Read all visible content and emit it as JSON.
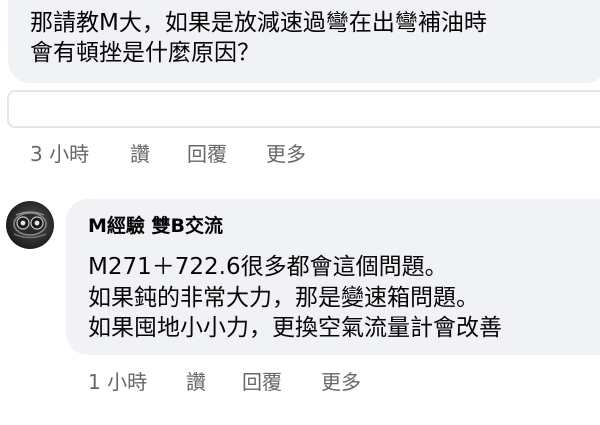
{
  "first_comment": {
    "text_line_1": "那請教M大，如果是放減速過彎在出彎補油時",
    "text_line_2": "會有頓挫是什麼原因？",
    "time": "3 小時",
    "like_label": "讚",
    "reply_label": "回覆",
    "more_label": "更多"
  },
  "reply_box": {
    "value": ""
  },
  "second_comment": {
    "author": "M經驗 雙B交流",
    "avatar_icon": "car-headlight-avatar",
    "message_lines": [
      "M271＋722.6很多都會這個問題。",
      "如果鈍的非常大力，那是變速箱問題。",
      "如果囤地小小力，更換空氣流量計會改善"
    ],
    "time": "1 小時",
    "like_label": "讚",
    "reply_label": "回覆",
    "more_label": "更多"
  },
  "colors": {
    "bubble_bg": "#f0f2f5",
    "text": "#050505",
    "secondary_text": "#65676b",
    "input_border": "#e4e6eb"
  }
}
